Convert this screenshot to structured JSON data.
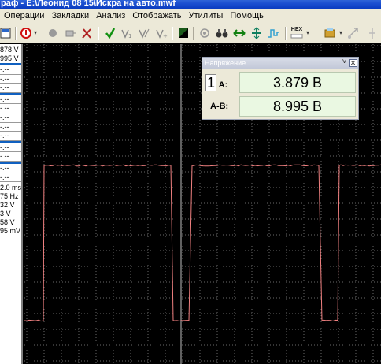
{
  "window": {
    "title": "раф - E:\\Леонид 08 15\\Искра на авто.mwf"
  },
  "menu": [
    "Операции",
    "Закладки",
    "Анализ",
    "Отображать",
    "Утилиты",
    "Помощь"
  ],
  "toolbar": {
    "icons": [
      "grid-icon",
      "stop-icon",
      "record-icon",
      "probe-icon",
      "tools-icon",
      "check-icon",
      "v-measure-icon",
      "v-measure-2-icon",
      "v-measure-3-icon",
      "invert-icon",
      "link-icon",
      "binoculars-icon",
      "arrows-icon",
      "zoom-icon",
      "signal-icon",
      "hex-icon",
      "settings-icon",
      "export-icon"
    ],
    "hex_label": "НЕХ"
  },
  "side_panel": {
    "values": [
      "878 V",
      "995 V",
      "-.--",
      "-.--",
      "-.--",
      "-.--",
      "-.--",
      "-.--",
      "-.--",
      "-.--",
      "-.--",
      "-.--",
      "-.--",
      "-.--",
      "2.0 ms",
      "75 Hz",
      "32 V",
      "3 V",
      "58 V",
      "95 mV"
    ]
  },
  "voltage_window": {
    "title": "Напряжение",
    "rows": [
      {
        "label": "A:",
        "prefix": "1",
        "value": "3.879 В"
      },
      {
        "label": "A-B:",
        "value": "8.995 В"
      }
    ]
  },
  "scope": {
    "grid_color": "#6a6a6a",
    "trace_color": "#f08080",
    "cursor_color": "#c0c0c0",
    "trace_high_level": 0.38,
    "trace_low_level": 0.865
  }
}
